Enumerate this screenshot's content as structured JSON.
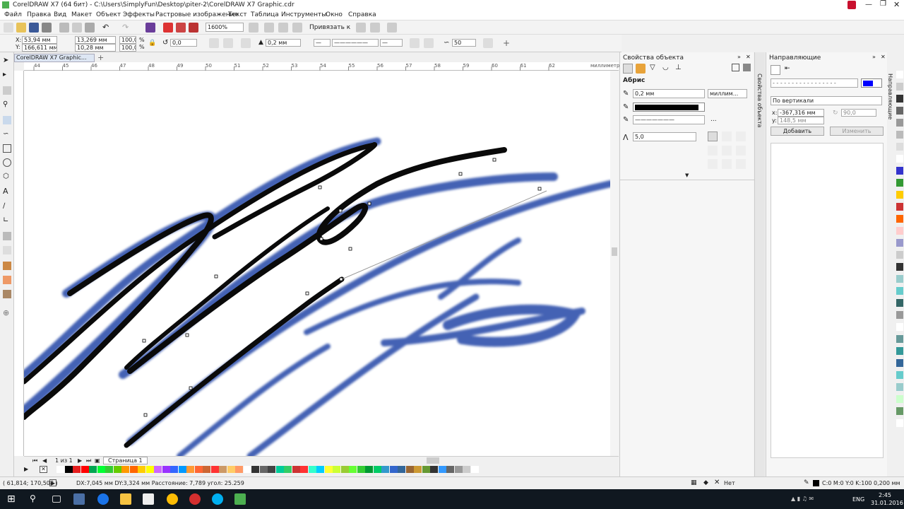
{
  "window": {
    "title": "CorelDRAW X7 (64 бит) - C:\\Users\\SimplyFun\\Desktop\\piter-2\\CorelDRAW X7 Graphic.cdr"
  },
  "menu": [
    "Файл",
    "Правка",
    "Вид",
    "Макет",
    "Объект",
    "Эффекты",
    "Растровые изображения",
    "Текст",
    "Таблица",
    "Инструменты",
    "Окно",
    "Справка"
  ],
  "toolbar": {
    "zoom": "1600%",
    "snap_label": "Привязать к"
  },
  "propbar": {
    "x": "53,94 мм",
    "y": "166,611 мм",
    "width": "13,269 мм",
    "height": "10,28 мм",
    "scale_x": "100,0",
    "scale_y": "100,0",
    "percent": "%",
    "rotation": "0,0",
    "outline": "0,2 мм",
    "smoothing": "50"
  },
  "doc_tab": "CorelDRAW X7 Graphic...",
  "ruler": {
    "unit": "миллиметры",
    "top_ticks": [
      "44",
      "45",
      "46",
      "47",
      "48",
      "49",
      "50",
      "51",
      "52",
      "53",
      "54",
      "55",
      "56",
      "57",
      "58",
      "59",
      "60",
      "61",
      "62"
    ]
  },
  "page_nav": {
    "pages": "1 из 1",
    "page_name": "Страница 1"
  },
  "object_properties": {
    "title": "Свойства объекта",
    "section": "Абрис",
    "width_value": "0,2 мм",
    "unit": "миллим...",
    "miter": "5,0",
    "ellipsis": "..."
  },
  "side_tab_label": "Свойства объекта",
  "guides_panel": {
    "title": "Направляющие",
    "orientation": "По вертикали",
    "x": "-367,316 мм",
    "y": "148,5 мм",
    "angle": "90,0",
    "add": "Добавить",
    "change": "Изменить",
    "color": "#0000ff"
  },
  "guides_side_tab": "Направляющие",
  "status": {
    "coords": "( 61,814; 170,508 )",
    "info": "DX:7,045 мм DY:3,324 мм Расстояние: 7,789 угол: 25.259",
    "fill": "Нет",
    "outline": "C:0 M:0 Y:0 K:100  0,200 мм"
  },
  "taskbar": {
    "time": "2:45",
    "date": "31.01.2016",
    "lang": "ENG"
  },
  "palette_colors": [
    "#ffffff",
    "#000000",
    "#e41d1d",
    "#ff0000",
    "#00a651",
    "#00ff33",
    "#33cc33",
    "#66cc00",
    "#ff9900",
    "#ff6600",
    "#ffcc00",
    "#ffff00",
    "#cc66ff",
    "#9933ff",
    "#3366ff",
    "#0099ff",
    "#ff9933",
    "#ff6633",
    "#cc6633",
    "#ff3333",
    "#cc9966",
    "#ffcc66",
    "#ff9966",
    "#ffffff",
    "#333333",
    "#666666",
    "#444444",
    "#00cc99",
    "#33cc66",
    "#cc3333",
    "#ff3333",
    "#33ffcc",
    "#00ccff",
    "#ffff33",
    "#ccff33",
    "#99cc33",
    "#66ff33",
    "#33cc33",
    "#009933",
    "#00cc66",
    "#3399cc",
    "#3366cc",
    "#336699",
    "#996633",
    "#cc9933",
    "#669933",
    "#333333",
    "#3399ff",
    "#666666",
    "#999999",
    "#cccccc",
    "#ffffff"
  ],
  "right_palette_colors": [
    "#ffffff",
    "#cccccc",
    "#333333",
    "#666666",
    "#999999",
    "#bbbbbb",
    "#dddddd",
    "#ffffff",
    "#3333cc",
    "#339933",
    "#ffcc00",
    "#cc3333",
    "#ff6600",
    "#ffcccc",
    "#9999cc",
    "#cccccc",
    "#333333",
    "#99cccc",
    "#66cccc",
    "#336666",
    "#999999",
    "#ffffff",
    "#669999",
    "#339999",
    "#336699",
    "#66cccc",
    "#99cccc",
    "#ccffcc",
    "#669966",
    "#ffffff"
  ]
}
